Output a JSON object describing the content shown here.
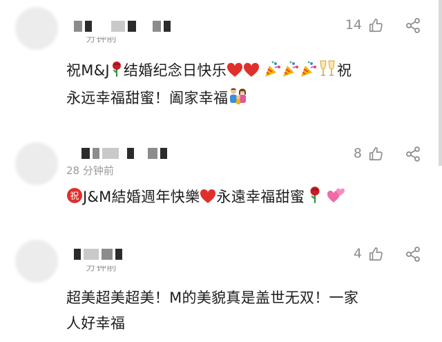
{
  "comments": [
    {
      "time": "分钟前",
      "likes": "14",
      "text_a": "祝M&J",
      "text_b": "结婚纪念日快乐",
      "text_c": "祝",
      "text_d": "永远幸福甜蜜！阖家幸福"
    },
    {
      "time": "28 分钟前",
      "likes": "8",
      "text_a": "J&M結婚週年快樂",
      "text_b": "永遠幸福甜蜜"
    },
    {
      "time": "分钟前",
      "likes": "4",
      "text_a": "超美超美超美！M的美貌真是盖世无双！一家",
      "text_b": "人好幸福"
    }
  ],
  "icons": {
    "like": "thumbs-up-icon",
    "share": "share-icon",
    "rose": "rose-icon",
    "heart": "red-heart-icon",
    "party": "party-popper-icon",
    "cheers": "clinking-glasses-icon",
    "family": "family-icon",
    "congrats": "congratulations-ideograph-icon",
    "two_hearts": "two-hearts-icon"
  },
  "colors": {
    "text": "#1c1c1c",
    "muted": "#8c8c8c",
    "heart": "#e0302b",
    "rose": "#c81d25",
    "pink": "#f06aa7"
  }
}
